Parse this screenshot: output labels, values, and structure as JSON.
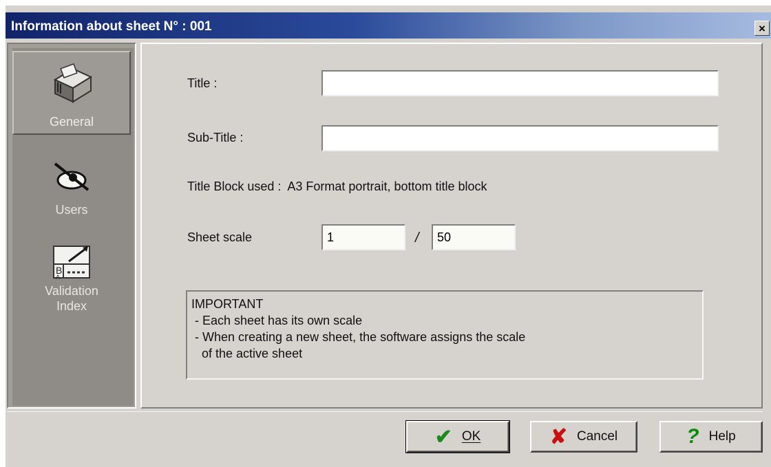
{
  "window": {
    "title": "Information about sheet N° : 001",
    "close_label": "×"
  },
  "sidebar": {
    "items": [
      {
        "label": "General",
        "icon": "folder-icon",
        "active": true
      },
      {
        "label": "Users",
        "icon": "users-icon",
        "active": false
      },
      {
        "label_line1": "Validation",
        "label_line2": "Index",
        "icon": "validation-index-icon",
        "active": false
      }
    ]
  },
  "form": {
    "title_label": "Title :",
    "title_value": "",
    "subtitle_label": "Sub-Title :",
    "subtitle_value": "",
    "title_block_text": "Title Block used :  A3 Format portrait, bottom title block",
    "scale_label": "Sheet scale",
    "scale_numerator": "1",
    "scale_separator": "/",
    "scale_denominator": "50"
  },
  "important": {
    "heading": "IMPORTANT",
    "line1": " - Each sheet has its own scale",
    "line2": " - When creating a new sheet, the software assigns the scale",
    "line3": "   of the active sheet"
  },
  "buttons": {
    "ok_label": "OK",
    "cancel_label": "Cancel",
    "help_label": "Help"
  }
}
